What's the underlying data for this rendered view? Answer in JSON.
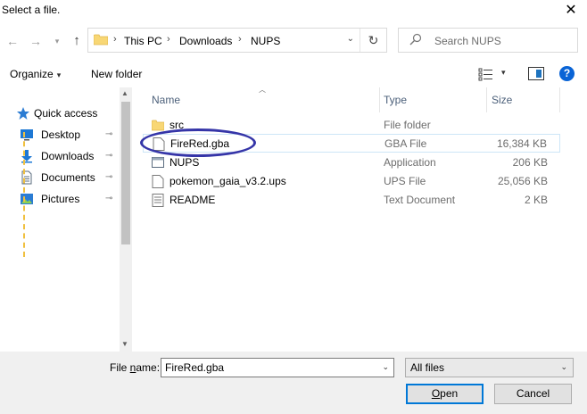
{
  "window": {
    "title": "Select a file.",
    "close_glyph": "✕"
  },
  "nav": {
    "back": "←",
    "forward": "→",
    "recent": "▾",
    "up": "↑",
    "breadcrumbs": [
      "This PC",
      "Downloads",
      "NUPS"
    ],
    "separator": "›",
    "address_dropdown": "⌄",
    "refresh": "↻"
  },
  "search": {
    "placeholder": "Search NUPS",
    "icon": "search-icon"
  },
  "toolbar": {
    "organize_label": "Organize",
    "organize_caret": "▾",
    "new_folder_label": "New folder",
    "view_caret": "▾",
    "help": "?"
  },
  "sidebar": {
    "quick_access": "Quick access",
    "items": [
      {
        "label": "Desktop",
        "icon": "desktop-icon",
        "pinned": true
      },
      {
        "label": "Downloads",
        "icon": "downloads-icon",
        "pinned": true
      },
      {
        "label": "Documents",
        "icon": "documents-icon",
        "pinned": true
      },
      {
        "label": "Pictures",
        "icon": "pictures-icon",
        "pinned": true
      }
    ],
    "pin_glyph": "📌"
  },
  "columns": {
    "name": "Name",
    "type": "Type",
    "size": "Size"
  },
  "files": [
    {
      "name": "src",
      "type": "File folder",
      "size": "",
      "icon": "folder-icon"
    },
    {
      "name": "FireRed.gba",
      "type": "GBA File",
      "size": "16,384 KB",
      "icon": "file-icon",
      "selected": true
    },
    {
      "name": "NUPS",
      "type": "Application",
      "size": "206 KB",
      "icon": "application-icon"
    },
    {
      "name": "pokemon_gaia_v3.2.ups",
      "type": "UPS File",
      "size": "25,056 KB",
      "icon": "file-icon"
    },
    {
      "name": "README",
      "type": "Text Document",
      "size": "2 KB",
      "icon": "text-document-icon"
    }
  ],
  "bottom": {
    "file_name_label_prefix": "File ",
    "file_name_label_underlined": "n",
    "file_name_label_suffix": "ame:",
    "file_name_value": "FireRed.gba",
    "filter_value": "All files",
    "open_underlined": "O",
    "open_rest": "pen",
    "cancel_label": "Cancel",
    "dropdown_glyph": "⌄"
  },
  "colors": {
    "accent": "#0078d7",
    "annotation": "#3535a8",
    "header_text": "#4c607a",
    "help": "#0a64d6"
  }
}
